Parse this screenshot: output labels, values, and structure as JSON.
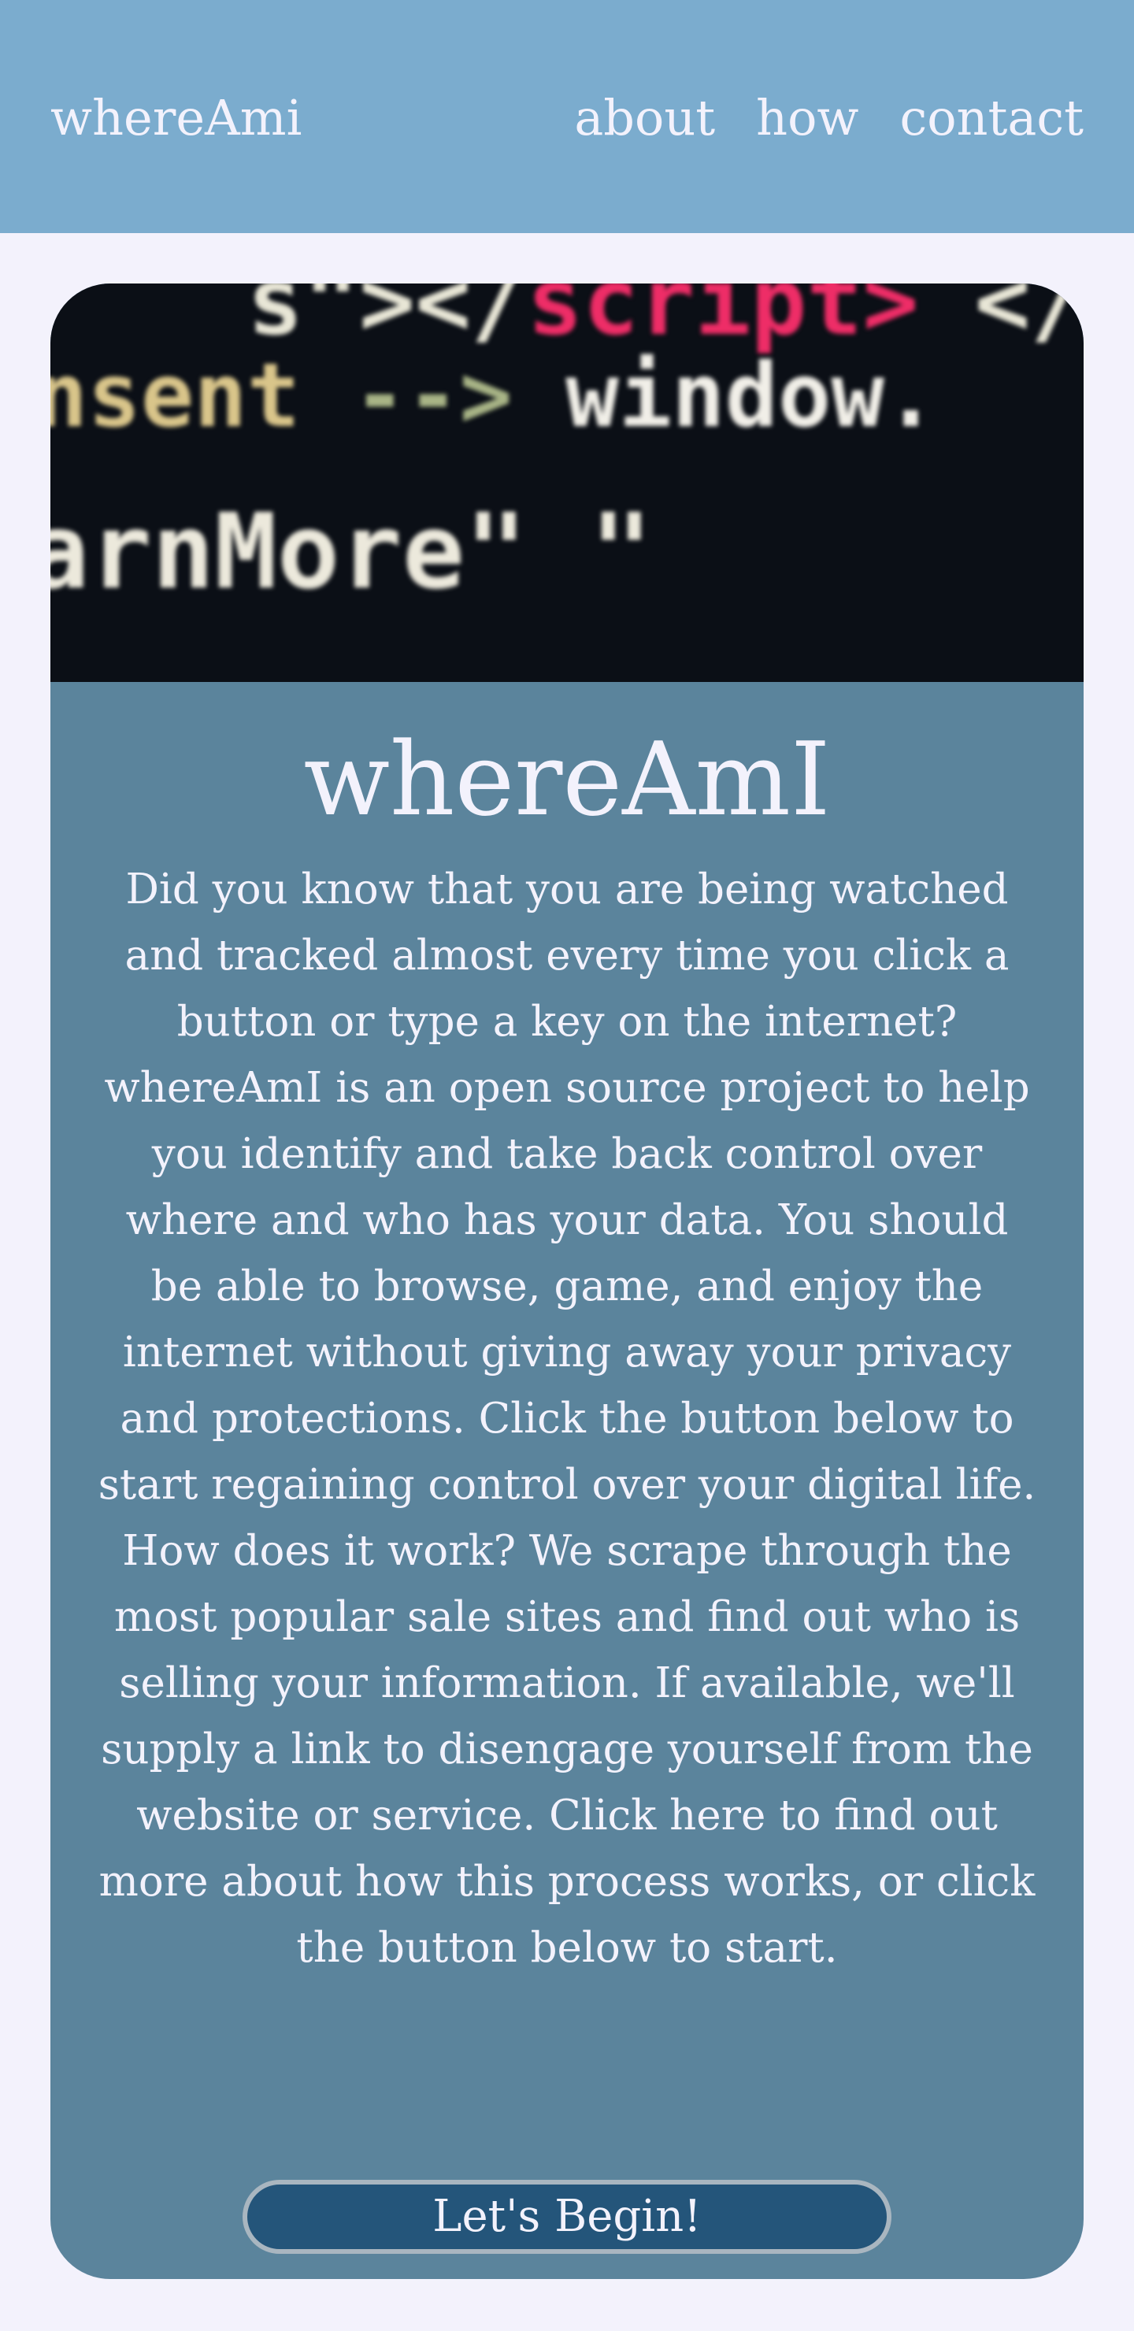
{
  "nav": {
    "brand": "whereAmi",
    "links": [
      "about",
      "how",
      "contact"
    ]
  },
  "hero": {
    "code_lines": [
      "s\"></",
      "nsent  --> window.",
      "arnMore\"  \""
    ]
  },
  "card": {
    "title": "whereAmI",
    "paragraphs": [
      "Did you know that you are being watched and tracked almost every time you click a button or type a key on the internet? whereAmI is an open source project to help you identify and take back control over where and who has your data. You should be able to browse, game, and enjoy the internet without giving away your privacy and protections. Click the button below to start regaining control over your digital life.",
      "How does it work? We scrape through the most popular sale sites and find out who is selling your information. If available, we'll supply a link to disengage yourself from the website or service. Click here to find out more about how this process works, or click the button below to start."
    ],
    "button_label": "Let's Begin!"
  },
  "colors": {
    "page_background": "#f3f2fc",
    "navbar": "#7bacce",
    "card": "#5b849c",
    "button": "#24557a",
    "text": "#f3f2fc"
  }
}
